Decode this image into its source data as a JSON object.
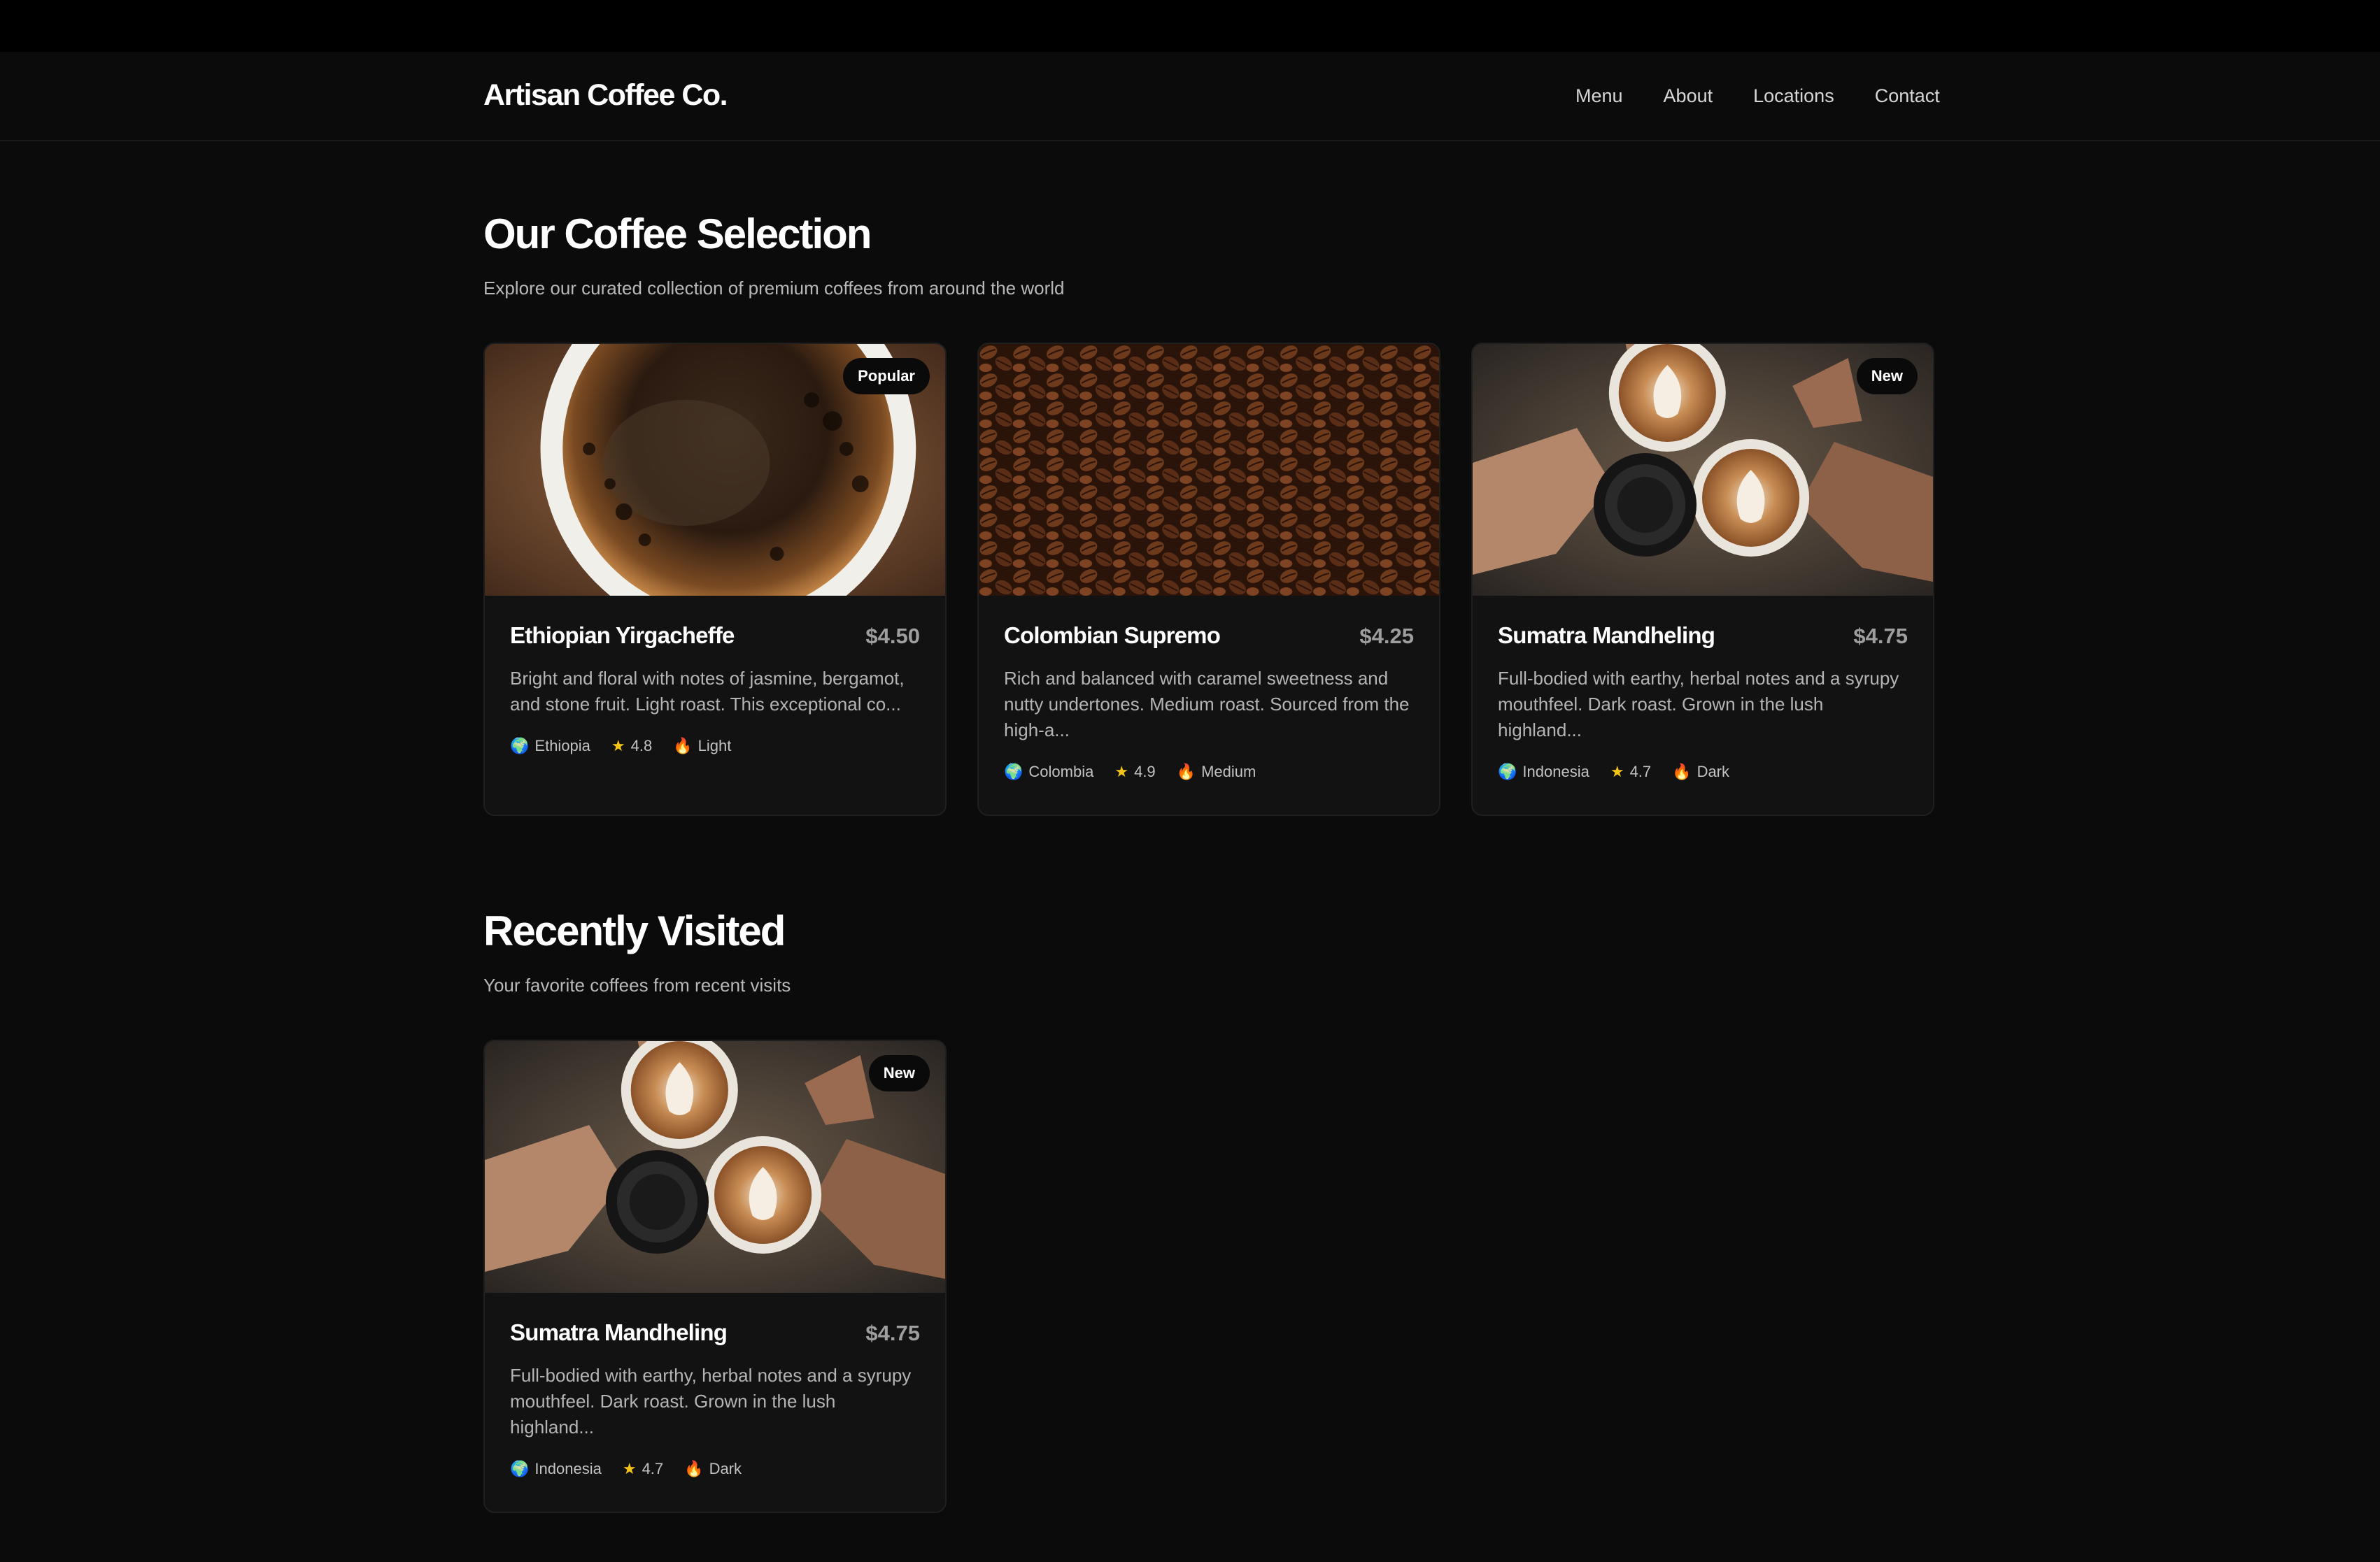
{
  "brand": "Artisan Coffee Co.",
  "nav": [
    "Menu",
    "About",
    "Locations",
    "Contact"
  ],
  "selection": {
    "title": "Our Coffee Selection",
    "subtitle": "Explore our curated collection of premium coffees from around the world",
    "cards": [
      {
        "name": "Ethiopian Yirgacheffe",
        "price": "$4.50",
        "badge": "Popular",
        "desc": "Bright and floral with notes of jasmine, bergamot, and stone fruit. Light roast. This exceptional co...",
        "origin": "Ethiopia",
        "rating": "4.8",
        "roast": "Light",
        "image": "coffee-cup-top-view"
      },
      {
        "name": "Colombian Supremo",
        "price": "$4.25",
        "badge": "",
        "desc": "Rich and balanced with caramel sweetness and nutty undertones. Medium roast. Sourced from the high-a...",
        "origin": "Colombia",
        "rating": "4.9",
        "roast": "Medium",
        "image": "coffee-beans"
      },
      {
        "name": "Sumatra Mandheling",
        "price": "$4.75",
        "badge": "New",
        "desc": "Full-bodied with earthy, herbal notes and a syrupy mouthfeel. Dark roast. Grown in the lush highland...",
        "origin": "Indonesia",
        "rating": "4.7",
        "roast": "Dark",
        "image": "latte-cheers"
      }
    ]
  },
  "recent": {
    "title": "Recently Visited",
    "subtitle": "Your favorite coffees from recent visits",
    "cards": [
      {
        "name": "Sumatra Mandheling",
        "price": "$4.75",
        "badge": "New",
        "desc": "Full-bodied with earthy, herbal notes and a syrupy mouthfeel. Dark roast. Grown in the lush highland...",
        "origin": "Indonesia",
        "rating": "4.7",
        "roast": "Dark",
        "image": "latte-cheers"
      }
    ]
  },
  "icons": {
    "origin": "globe-icon",
    "rating": "star-icon",
    "roast": "flame-icon"
  },
  "colors": {
    "background": "#0b0b0b",
    "card": "#121212",
    "star": "#f5c518",
    "flame": "#f26b1d"
  }
}
